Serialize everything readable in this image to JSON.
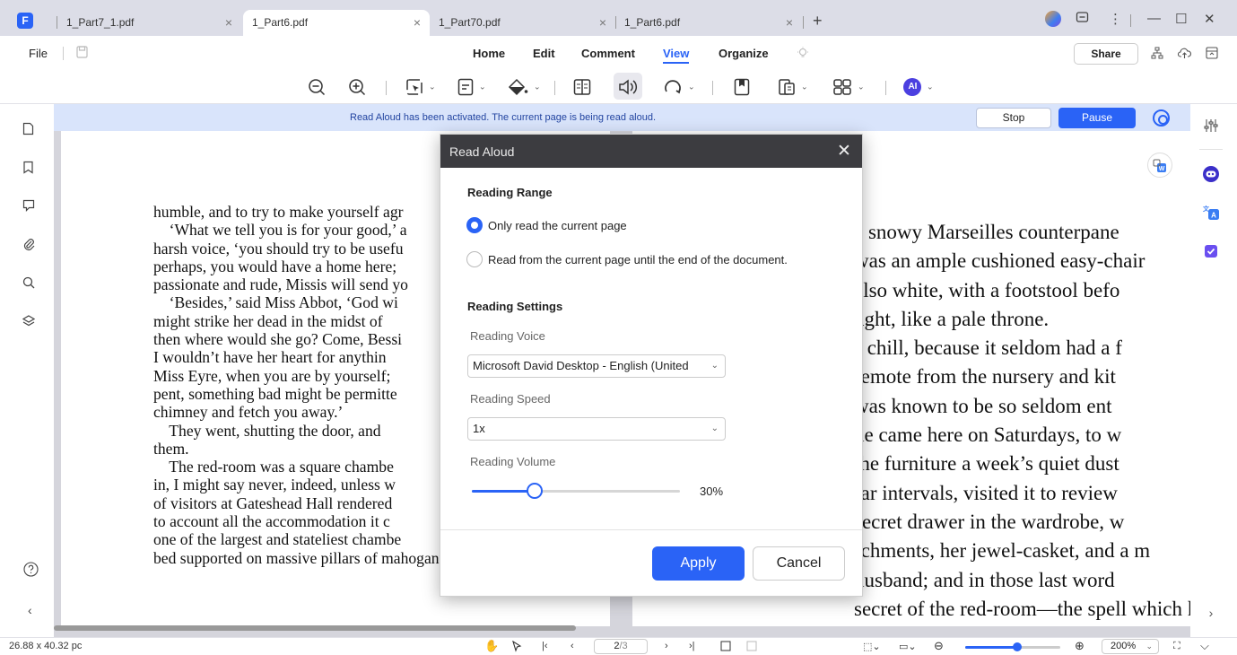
{
  "tabs": [
    {
      "label": "1_Part7_1.pdf",
      "close": "×"
    },
    {
      "label": "1_Part6.pdf",
      "close": "×"
    },
    {
      "label": "1_Part70.pdf",
      "close": "×"
    },
    {
      "label": "1_Part6.pdf",
      "close": "×"
    }
  ],
  "tab_add": "+",
  "app_logo": "F",
  "menu": {
    "file": "File",
    "items": [
      "Home",
      "Edit",
      "Comment",
      "View",
      "Organize"
    ],
    "active": "View",
    "share": "Share"
  },
  "toolbar": {
    "dropdown_glyph": "⌄",
    "ai_label": "AI"
  },
  "notice": {
    "text": "Read Aloud has been activated. The current page is being read aloud.",
    "stop": "Stop",
    "pause": "Pause"
  },
  "left_page_lines": [
    "humble, and to try to make yourself agr",
    "    ‘What we tell you is for your good,’ a",
    "harsh voice, ‘you should try to be usefu",
    "perhaps, you would have a home here;",
    "passionate and rude, Missis will send yo",
    "    ‘Besides,’ said Miss Abbot, ‘God wi",
    "might strike her dead in the midst of",
    "then where would she go? Come, Bessi",
    "I wouldn’t have her heart for anythin",
    "Miss Eyre, when you are by yourself;",
    "pent, something bad might be permitte",
    "chimney and fetch you away.’",
    "    They went, shutting the door, and",
    "them.",
    "    The red-room was a square chambe",
    "in, I might say never, indeed, unless w",
    "of visitors at Gateshead Hall rendered",
    "to account all the accommodation it c",
    "one of the largest and stateliest chambe",
    "bed supported on massive pillars of mahogany, hung with"
  ],
  "right_page_lines": [
    "a snowy Marseilles counterpane",
    "was an ample cushioned easy-chair",
    "also white, with a footstool befo",
    "ught, like a pale throne.",
    "s chill, because it seldom had a f",
    "remote from the nursery and kit",
    "was known to be so seldom ent",
    "he came here on Saturdays, to w",
    "the furniture a week’s quiet dust",
    "far intervals, visited it to review",
    "secret drawer in the wardrobe, w",
    "rchments, her jewel-casket, and a m",
    "husband; and in those last word",
    "secret of the red-room—the spell which kept it so"
  ],
  "dialog": {
    "title": "Read Aloud",
    "close": "✕",
    "range_title": "Reading Range",
    "range_options": [
      {
        "label": "Only read the current page",
        "checked": true
      },
      {
        "label": "Read from the current page until the end of the document.",
        "checked": false
      }
    ],
    "settings_title": "Reading Settings",
    "voice_label": "Reading Voice",
    "voice_value": "Microsoft David Desktop - English (United",
    "speed_label": "Reading Speed",
    "speed_value": "1x",
    "volume_label": "Reading Volume",
    "volume_value": "30%",
    "volume_fraction": 0.3,
    "apply": "Apply",
    "cancel": "Cancel"
  },
  "status": {
    "dimensions": "26.88 x 40.32 pc",
    "page_current": "2",
    "page_total": "/3",
    "zoom": "200%",
    "zoom_fraction": 0.55
  },
  "colors": {
    "accent": "#2a63f6",
    "dialog_header": "#3c3c40",
    "notice_bg": "#d9e4fb"
  }
}
